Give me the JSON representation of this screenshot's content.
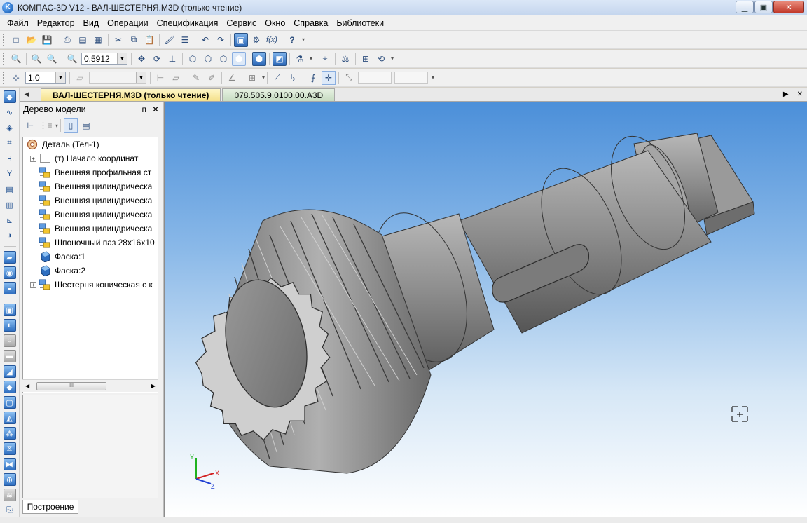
{
  "window": {
    "title": "КОМПАС-3D V12 - ВАЛ-ШЕСТЕРНЯ.M3D (только чтение)",
    "app_icon_letter": "K",
    "minimize": "▁",
    "maximize": "▣",
    "close": "✕"
  },
  "menu": [
    "Файл",
    "Редактор",
    "Вид",
    "Операции",
    "Спецификация",
    "Сервис",
    "Окно",
    "Справка",
    "Библиотеки"
  ],
  "toolbar2": {
    "zoom_value": "0.5912"
  },
  "toolbar3": {
    "step_value": "1.0"
  },
  "doc_tabs": {
    "active": "ВАЛ-ШЕСТЕРНЯ.M3D (только чтение)",
    "inactive": "078.505.9.0100.00.A3D",
    "left_nav": "◀",
    "right_nav": "▶",
    "close": "✕"
  },
  "model_tree": {
    "title": "Дерево модели",
    "pin": "ᴨ",
    "close": "✕",
    "root": "Деталь (Тел-1)",
    "items": [
      {
        "label": "(т) Начало координат",
        "expandable": true,
        "icon": "origin-icon"
      },
      {
        "label": "Внешняя профильная ст",
        "expandable": false,
        "icon": "sketch-op-icon"
      },
      {
        "label": "Внешняя цилиндрическа",
        "expandable": false,
        "icon": "sketch-op-icon"
      },
      {
        "label": "Внешняя цилиндрическа",
        "expandable": false,
        "icon": "sketch-op-icon"
      },
      {
        "label": "Внешняя цилиндрическа",
        "expandable": false,
        "icon": "sketch-op-icon"
      },
      {
        "label": "Внешняя цилиндрическа",
        "expandable": false,
        "icon": "sketch-op-icon"
      },
      {
        "label": "Шпоночный паз 28x16x10",
        "expandable": false,
        "icon": "sketch-op-icon"
      },
      {
        "label": "Фаска:1",
        "expandable": false,
        "icon": "chamfer-icon"
      },
      {
        "label": "Фаска:2",
        "expandable": false,
        "icon": "chamfer-icon"
      },
      {
        "label": "Шестерня коническая с к",
        "expandable": true,
        "icon": "sketch-op-icon"
      }
    ],
    "scroll_thumb": "III",
    "bottom_tab": "Построение"
  },
  "viewport": {
    "axes": {
      "x": "X",
      "y": "Y",
      "z": "Z"
    }
  },
  "colors": {
    "viewport_top": "#4b8fd9",
    "viewport_bottom": "#ffffff",
    "part_grey": "#8c8c8c",
    "active_tab": "#f4e08a"
  }
}
